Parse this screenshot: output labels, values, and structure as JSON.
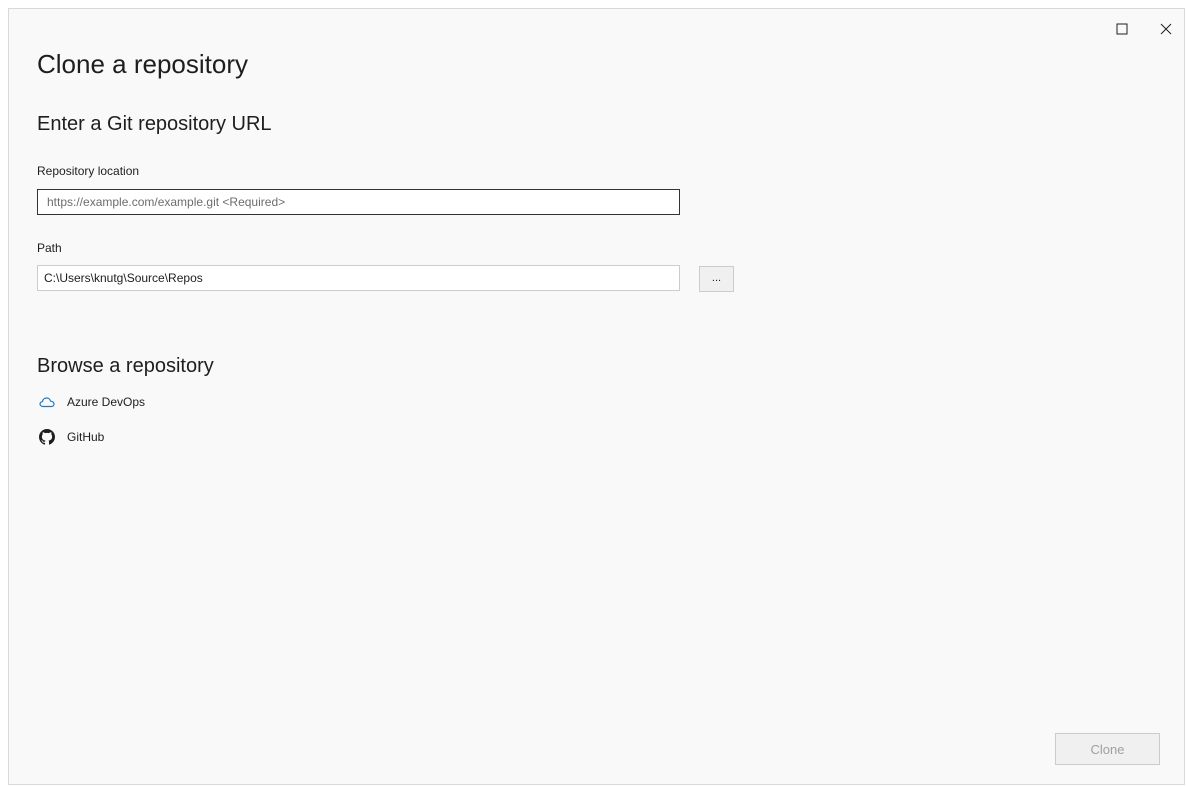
{
  "window": {
    "title": "Clone a repository"
  },
  "git_url_section": {
    "heading": "Enter a Git repository URL",
    "repository_location_label": "Repository location",
    "repository_location_placeholder": "https://example.com/example.git <Required>",
    "repository_location_value": "",
    "path_label": "Path",
    "path_value": "C:\\Users\\knutg\\Source\\Repos",
    "browse_button_label": "..."
  },
  "browse_section": {
    "heading": "Browse a repository",
    "providers": [
      {
        "label": "Azure DevOps",
        "icon": "cloud-icon",
        "icon_color": "#1f7ac2"
      },
      {
        "label": "GitHub",
        "icon": "github-icon",
        "icon_color": "#1e1e1e"
      }
    ]
  },
  "footer": {
    "clone_button_label": "Clone"
  },
  "colors": {
    "window_background": "#f9f9f9",
    "disabled_text": "#a0a0a0"
  }
}
